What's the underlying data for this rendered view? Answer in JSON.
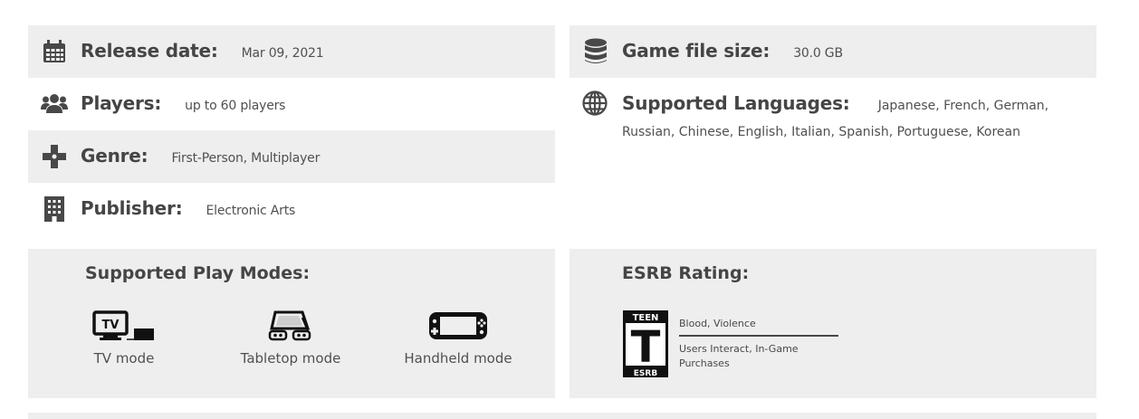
{
  "details": {
    "release": {
      "label": "Release date:",
      "value": "Mar 09, 2021"
    },
    "players": {
      "label": "Players:",
      "value": "up to 60 players"
    },
    "genre": {
      "label": "Genre:",
      "value": "First-Person, Multiplayer"
    },
    "publisher": {
      "label": "Publisher:",
      "value": "Electronic Arts"
    },
    "file_size": {
      "label": "Game file size:",
      "value": "30.0 GB"
    },
    "languages": {
      "label": "Supported Languages:",
      "value_line1": "Japanese, French, German,",
      "value_line2": "Russian, Chinese, English, Italian, Spanish, Portuguese, Korean"
    }
  },
  "play_modes": {
    "title": "Supported Play Modes:",
    "modes": [
      {
        "label": "TV mode",
        "icon": "tv-mode-icon"
      },
      {
        "label": "Tabletop mode",
        "icon": "tabletop-mode-icon"
      },
      {
        "label": "Handheld mode",
        "icon": "handheld-mode-icon"
      }
    ]
  },
  "esrb": {
    "title": "ESRB Rating:",
    "rating_top": "TEEN",
    "rating_letter": "T",
    "rating_bottom": "ESRB",
    "descriptors": "Blood, Violence",
    "interactive": "Users Interact, In-Game Purchases"
  },
  "colors": {
    "shade": "#eeeeee",
    "text": "#484848"
  }
}
